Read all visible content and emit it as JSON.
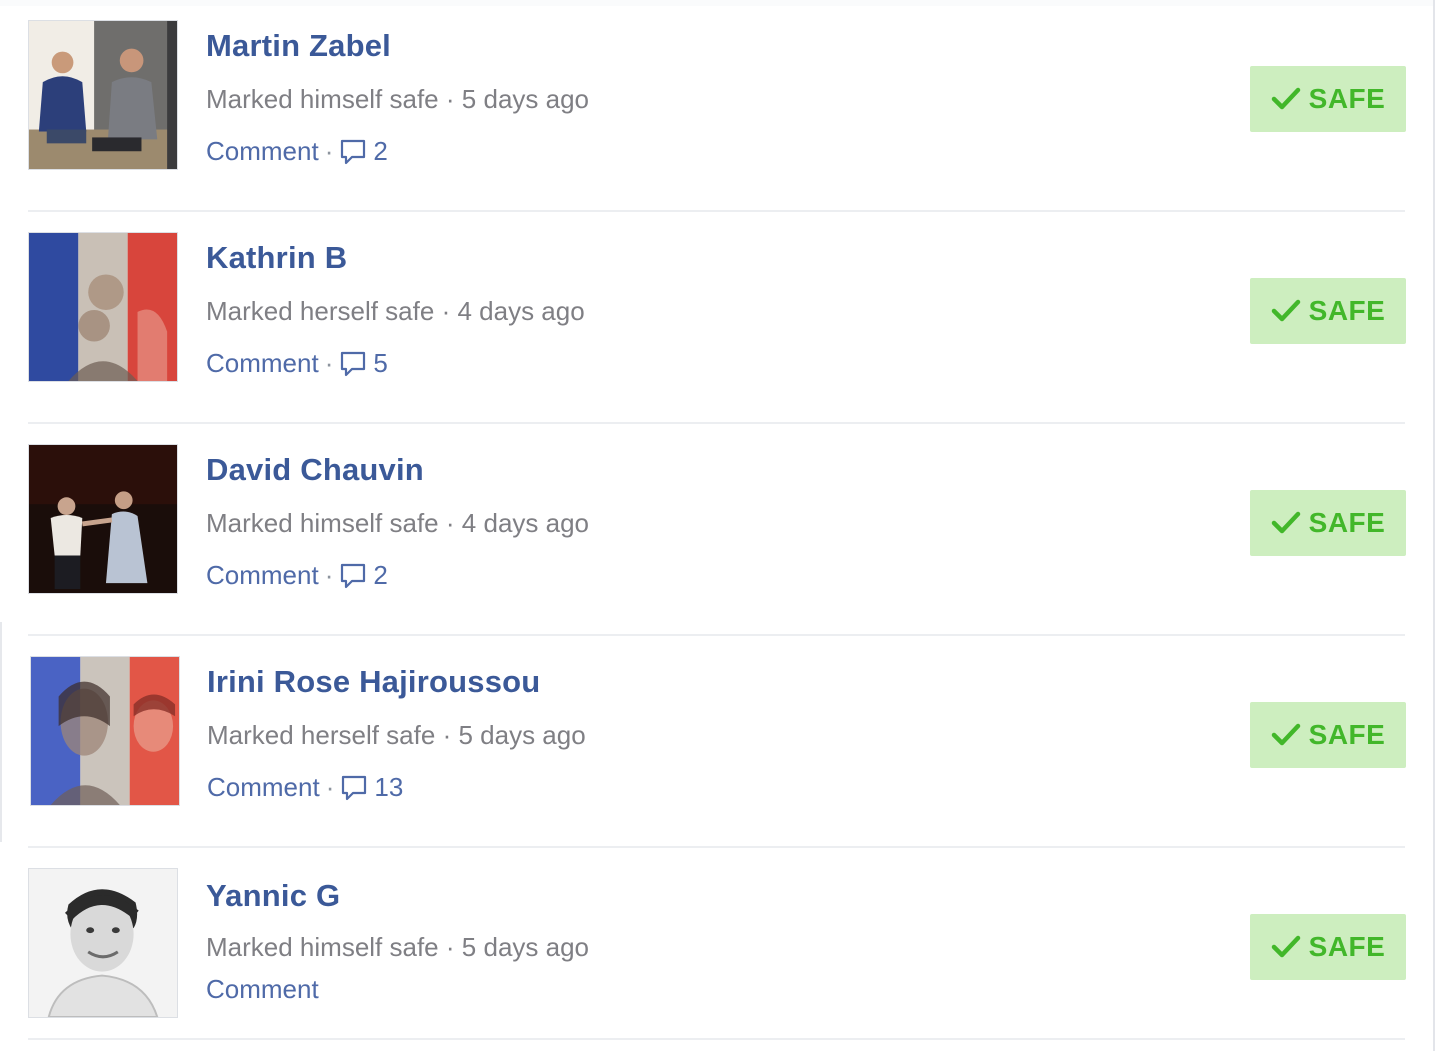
{
  "people": [
    {
      "name": "Martin Zabel",
      "status": "Marked himself safe",
      "time": "5 days ago",
      "comment_label": "Comment",
      "comment_count": "2",
      "badge": "SAFE",
      "avatar_icon": "photo-two-men-seated"
    },
    {
      "name": "Kathrin B",
      "status": "Marked herself safe",
      "time": "4 days ago",
      "comment_label": "Comment",
      "comment_count": "5",
      "badge": "SAFE",
      "avatar_icon": "photo-french-flag-overlay"
    },
    {
      "name": "David Chauvin",
      "status": "Marked himself safe",
      "time": "4 days ago",
      "comment_label": "Comment",
      "comment_count": "2",
      "badge": "SAFE",
      "avatar_icon": "photo-dancing-couple"
    },
    {
      "name": "Irini Rose Hajiroussou",
      "status": "Marked herself safe",
      "time": "5 days ago",
      "comment_label": "Comment",
      "comment_count": "13",
      "badge": "SAFE",
      "avatar_icon": "photo-french-flag-overlay"
    },
    {
      "name": "Yannic G",
      "status": "Marked himself safe",
      "time": "5 days ago",
      "comment_label": "Comment",
      "comment_count": "",
      "badge": "SAFE",
      "avatar_icon": "photo-portrait-bw"
    }
  ],
  "separator": "·",
  "colors": {
    "name": "#3b5998",
    "meta": "#7f7f84",
    "link": "#4f6aa8",
    "safe_bg": "#cdeebf",
    "safe_text": "#42b72a"
  }
}
